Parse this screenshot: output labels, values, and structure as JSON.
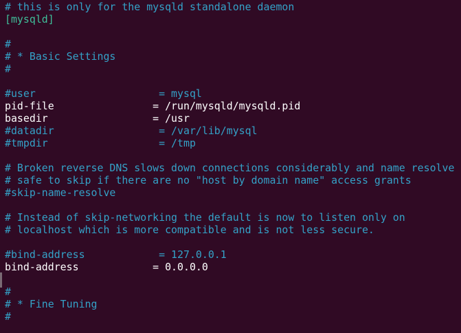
{
  "terminal": {
    "lines": [
      {
        "text": "# this is only for the mysqld standalone daemon",
        "kind": "comment"
      },
      {
        "text": "[mysqld]",
        "kind": "section"
      },
      {
        "text": "",
        "kind": "blank"
      },
      {
        "text": "#",
        "kind": "comment"
      },
      {
        "text": "# * Basic Settings",
        "kind": "comment"
      },
      {
        "text": "#",
        "kind": "comment"
      },
      {
        "text": "",
        "kind": "blank"
      },
      {
        "text": "#user                    = mysql",
        "kind": "comment"
      },
      {
        "text": "pid-file                = /run/mysqld/mysqld.pid",
        "kind": "setting"
      },
      {
        "text": "basedir                 = /usr",
        "kind": "setting"
      },
      {
        "text": "#datadir                 = /var/lib/mysql",
        "kind": "comment"
      },
      {
        "text": "#tmpdir                  = /tmp",
        "kind": "comment"
      },
      {
        "text": "",
        "kind": "blank"
      },
      {
        "text": "# Broken reverse DNS slows down connections considerably and name resolve",
        "kind": "comment"
      },
      {
        "text": "# safe to skip if there are no \"host by domain name\" access grants",
        "kind": "comment"
      },
      {
        "text": "#skip-name-resolve",
        "kind": "comment"
      },
      {
        "text": "",
        "kind": "blank"
      },
      {
        "text": "# Instead of skip-networking the default is now to listen only on",
        "kind": "comment"
      },
      {
        "text": "# localhost which is more compatible and is not less secure.",
        "kind": "comment"
      },
      {
        "text": "",
        "kind": "blank"
      },
      {
        "text": "#bind-address            = 127.0.0.1",
        "kind": "comment"
      },
      {
        "text": "bind-address            = 0.0.0.0",
        "kind": "setting"
      },
      {
        "text": "",
        "kind": "blank"
      },
      {
        "text": "#",
        "kind": "comment"
      },
      {
        "text": "# * Fine Tuning",
        "kind": "comment"
      },
      {
        "text": "#",
        "kind": "comment"
      }
    ]
  }
}
